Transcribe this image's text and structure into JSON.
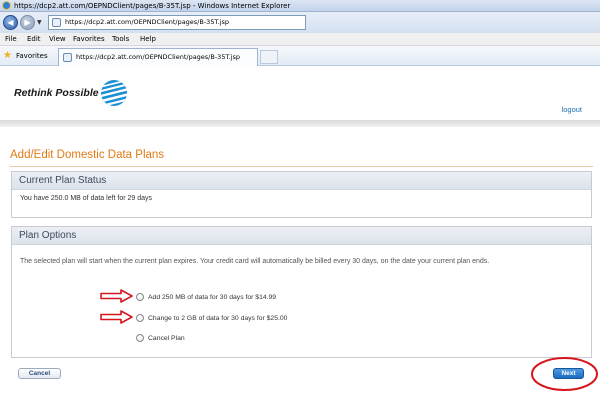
{
  "browser": {
    "title": "https://dcp2.att.com/OEPNDClient/pages/B-35T.jsp - Windows Internet Explorer",
    "url": "https://dcp2.att.com/OEPNDClient/pages/B-35T.jsp",
    "menu": [
      "File",
      "Edit",
      "View",
      "Favorites",
      "Tools",
      "Help"
    ],
    "favorites_label": "Favorites",
    "tab_title": "https://dcp2.att.com/OEPNDClient/pages/B-35T.jsp"
  },
  "header": {
    "brand_text": "Rethink Possible",
    "logout_label": "logout"
  },
  "page": {
    "title": "Add/Edit Domestic Data Plans"
  },
  "current_status": {
    "heading": "Current Plan Status",
    "text": "You have 250.0 MB of data left for 29 days"
  },
  "plan_options": {
    "heading": "Plan Options",
    "description": "The selected plan will start when the current plan expires. Your credit card will automatically be billed every 30 days, on the date your current plan ends.",
    "options": [
      "Add 250 MB of data for 30 days for $14.99",
      "Change to 2 GB of data for 30 days for $25.00",
      "Cancel Plan"
    ]
  },
  "buttons": {
    "cancel": "Cancel",
    "next": "Next"
  },
  "colors": {
    "accent_orange": "#e07a14",
    "link_blue": "#1f6fb5",
    "annotation_red": "#d8141c",
    "next_button_blue": "#1a6cc2"
  }
}
